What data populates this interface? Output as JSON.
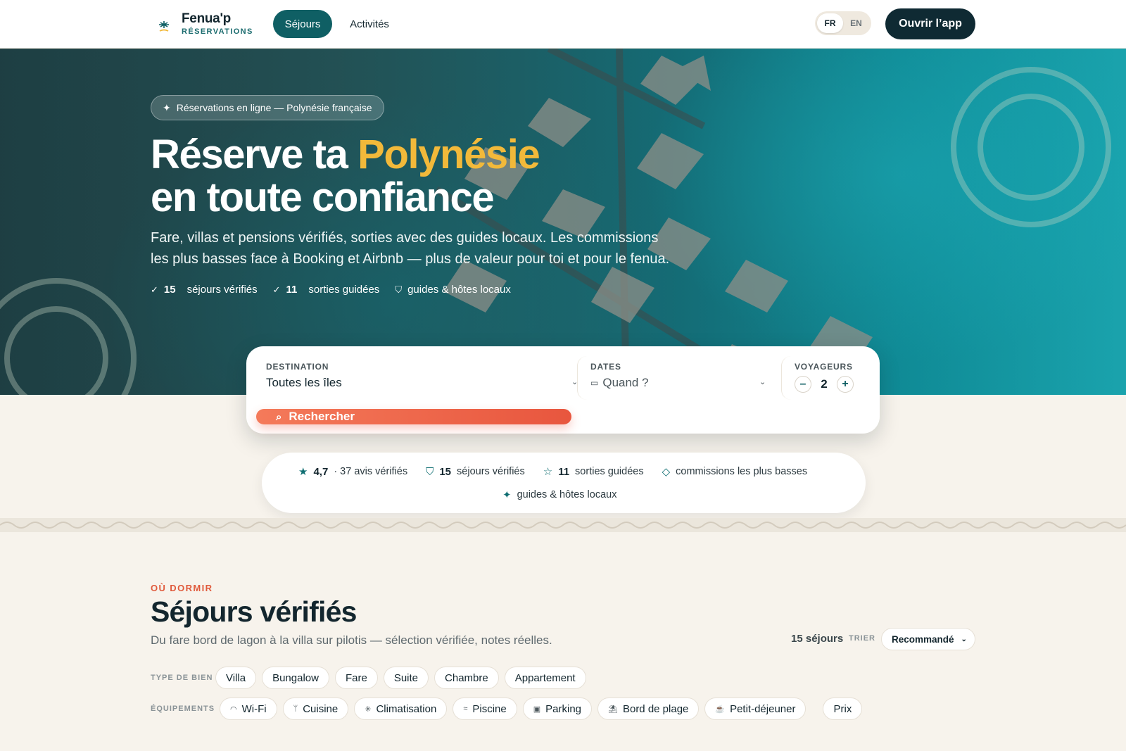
{
  "nav": {
    "brand_name": "Fenua'p",
    "brand_sub": "RÉSERVATIONS",
    "tabs": [
      {
        "label": "Séjours"
      },
      {
        "label": "Activités"
      }
    ],
    "lang": {
      "fr": "FR",
      "en": "EN"
    },
    "open_app": "Ouvrir l’app"
  },
  "hero": {
    "pill": "Réservations en ligne — Polynésie française",
    "title_line1_pre": "Réserve ta ",
    "title_line1_accent": "Polynésie",
    "title_line2": "en toute confiance",
    "lead_line1": "Fare, villas et pensions vérifiés, sorties avec des guides locaux. Les commissions",
    "lead_line2": "les plus basses face à Booking et Airbnb — plus de valeur pour toi et pour le fenua.",
    "stats": [
      {
        "value": "15",
        "label": "séjours vérifiés"
      },
      {
        "value": "11",
        "label": "sorties guidées"
      },
      {
        "label": "guides & hôtes locaux"
      }
    ]
  },
  "search": {
    "destination_label": "DESTINATION",
    "destination_value": "Toutes les îles",
    "dates_label": "DATES",
    "dates_placeholder": "Quand ?",
    "travelers_label": "VOYAGEURS",
    "travelers_value": "2",
    "minus": "–",
    "plus": "+",
    "button": "Rechercher"
  },
  "trust": {
    "rating": "4,7",
    "rating_reviews": "· 37 avis vérifiés",
    "stays_value": "15",
    "stays_label": "séjours vérifiés",
    "tours_value": "11",
    "tours_label": "sorties guidées",
    "commissions": "commissions les plus basses",
    "guides": "guides & hôtes locaux"
  },
  "section": {
    "eyebrow": "OÙ DORMIR",
    "title": "Séjours vérifiés",
    "subtitle": "Du fare bord de lagon à la villa sur pilotis — sélection vérifiée, notes réelles.",
    "count": "15 séjours",
    "sort_label": "TRIER",
    "sort_value": "Recommandé",
    "type_label": "TYPE DE BIEN",
    "types": [
      "Villa",
      "Bungalow",
      "Fare",
      "Suite",
      "Chambre",
      "Appartement"
    ],
    "equip_label": "ÉQUIPEMENTS",
    "equipments": [
      "Wi-Fi",
      "Cuisine",
      "Climatisation",
      "Piscine",
      "Parking",
      "Bord de plage",
      "Petit-déjeuner"
    ],
    "price": "Prix"
  },
  "colors": {
    "teal": "#0f5f64",
    "accent_yellow": "#f2b93a",
    "coral": "#e8563e",
    "navy": "#0f2a33",
    "cream": "#f7f3ec"
  }
}
